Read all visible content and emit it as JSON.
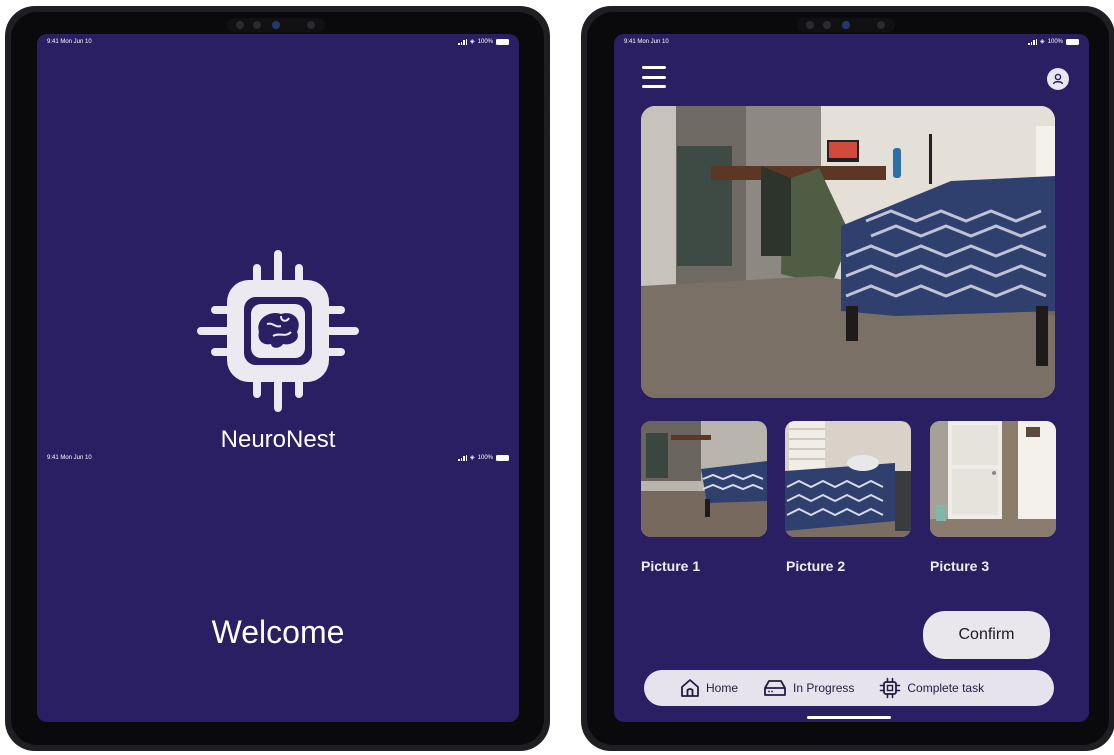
{
  "left_screen": {
    "status_time": "9:41  Mon Jun 10",
    "status_battery": "100%",
    "app_name": "NeuroNest",
    "status2_time": "9:41  Mon Jun 10",
    "status2_battery": "100%",
    "welcome": "Welcome",
    "logo_icon": "brain-chip-icon"
  },
  "right_screen": {
    "status_time": "9:41  Mon Jun 10",
    "status_battery": "100%",
    "icons": {
      "menu": "hamburger-menu-icon",
      "profile": "user-profile-icon"
    },
    "thumbnails": [
      {
        "label": "Picture 1"
      },
      {
        "label": "Picture 2"
      },
      {
        "label": "Picture 3"
      }
    ],
    "confirm_label": "Confirm",
    "nav": [
      {
        "label": "Home",
        "icon": "home-icon"
      },
      {
        "label": "In Progress",
        "icon": "drive-icon"
      },
      {
        "label": "Complete task",
        "icon": "chip-icon"
      }
    ]
  },
  "colors": {
    "screen_background": "#2b1f63",
    "device_frame": "#1f1f23",
    "button_surface": "#e9e6ec",
    "logo": "#ece9f0"
  }
}
